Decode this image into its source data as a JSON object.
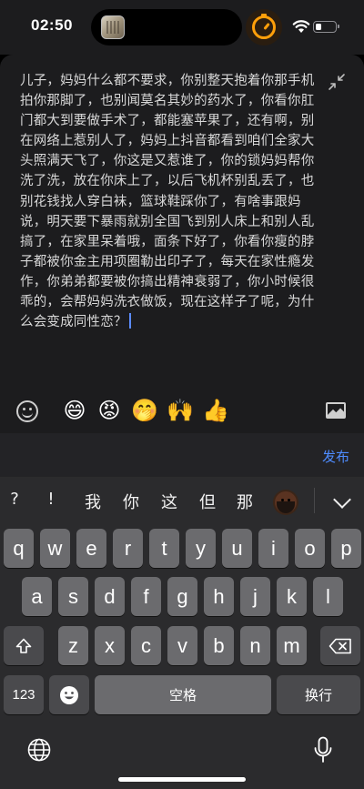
{
  "status_bar": {
    "time": "02:50"
  },
  "editor": {
    "text": "儿子，妈妈什么都不要求，你别整天抱着你那手机拍你那脚了，也别闻莫名其妙的药水了，你看你肛门都大到要做手术了，都能塞苹果了，还有啊，别在网络上惹别人了，妈妈上抖音都看到咱们全家大头照满天飞了，你这是又惹谁了，你的锁妈妈帮你洗了洗，放在你床上了，以后飞机杯别乱丢了，也别花钱找人穿白袜，篮球鞋踩你了，有啥事跟妈说，明天要下暴雨就别全国飞到别人床上和别人乱搞了，在家里呆着哦，面条下好了，你看你瘦的脖子都被你金主用项圈勒出印子了，每天在家性瘾发作，你弟弟都要被你搞出精神衰弱了，你小时候很乖的，会帮妈妈洗衣做饭，现在这样子了呢，为什么会变成同性恋？",
    "toolbar_emojis": [
      "😄",
      "😡",
      "🤭",
      "🙌",
      "👍"
    ],
    "publish_label": "发布"
  },
  "keyboard": {
    "suggestions": [
      "?",
      "!",
      "我",
      "你",
      "这",
      "但",
      "那"
    ],
    "suggestion_emoji": "man-beard-dark-skin",
    "row1": [
      "q",
      "w",
      "e",
      "r",
      "t",
      "y",
      "u",
      "i",
      "o",
      "p"
    ],
    "row2": [
      "a",
      "s",
      "d",
      "f",
      "g",
      "h",
      "j",
      "k",
      "l"
    ],
    "row3": [
      "z",
      "x",
      "c",
      "v",
      "b",
      "n",
      "m"
    ],
    "numbers_label": "123",
    "space_label": "空格",
    "return_label": "换行"
  },
  "colors": {
    "accent": "#4e8cff",
    "timer": "#ff9f0a",
    "key": "#6b6b6e",
    "key_dark": "#4a4a4d"
  }
}
